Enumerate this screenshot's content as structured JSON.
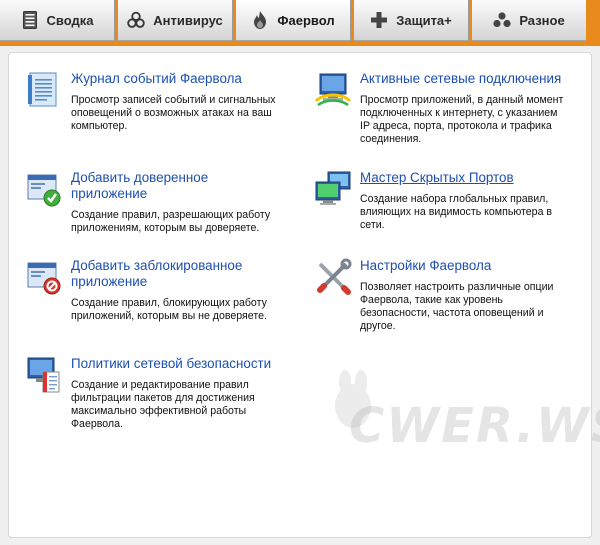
{
  "tabs": [
    {
      "label": "Сводка",
      "icon": "list-icon",
      "active": false
    },
    {
      "label": "Антивирус",
      "icon": "biohazard-icon",
      "active": false
    },
    {
      "label": "Фаервол",
      "icon": "flame-icon",
      "active": true
    },
    {
      "label": "Защита+",
      "icon": "plus-icon",
      "active": false
    },
    {
      "label": "Разное",
      "icon": "dots-icon",
      "active": false
    }
  ],
  "items": [
    {
      "title": "Журнал событий Фаервола",
      "desc": [
        "Просмотр записей событий и сигнальных",
        "оповещений о возможных атаках на ваш",
        "компьютер."
      ],
      "icon": "log-document-icon"
    },
    {
      "title": "Активные сетевые подключения",
      "desc": [
        "Просмотр приложений, в данный момент",
        "подключенных к интернету, с указанием",
        "IP адреса, порта, протокола и трафика",
        "соединения."
      ],
      "icon": "network-connections-icon"
    },
    {
      "title": [
        "Добавить доверенное",
        "приложение"
      ],
      "desc": [
        "Создание правил, разрешающих работу",
        "приложениям, которым вы доверяете."
      ],
      "icon": "trusted-app-icon"
    },
    {
      "title": "Мастер Скрытых Портов",
      "desc": [
        "Создание набора глобальных правил,",
        "влияющих на видимость компьютера в",
        "сети."
      ],
      "icon": "stealth-ports-icon"
    },
    {
      "title": [
        "Добавить заблокированное",
        "приложение"
      ],
      "desc": [
        "Создание правил, блокирующих работу",
        "приложений, которым вы не доверяете."
      ],
      "icon": "blocked-app-icon"
    },
    {
      "title": "Настройки Фаервола",
      "desc": [
        "Позволяет настроить различные опции",
        "Фаервола, такие как уровень",
        "безопасности, частота оповещений и",
        "другое."
      ],
      "icon": "settings-tools-icon"
    },
    {
      "title": "Политики сетевой безопасности",
      "desc": [
        "Создание и редактирование правил",
        "фильтрации пакетов для достижения",
        "максимально эффективной работы",
        "Фаервола."
      ],
      "icon": "network-policy-icon"
    }
  ],
  "watermark": "CWER.WS"
}
